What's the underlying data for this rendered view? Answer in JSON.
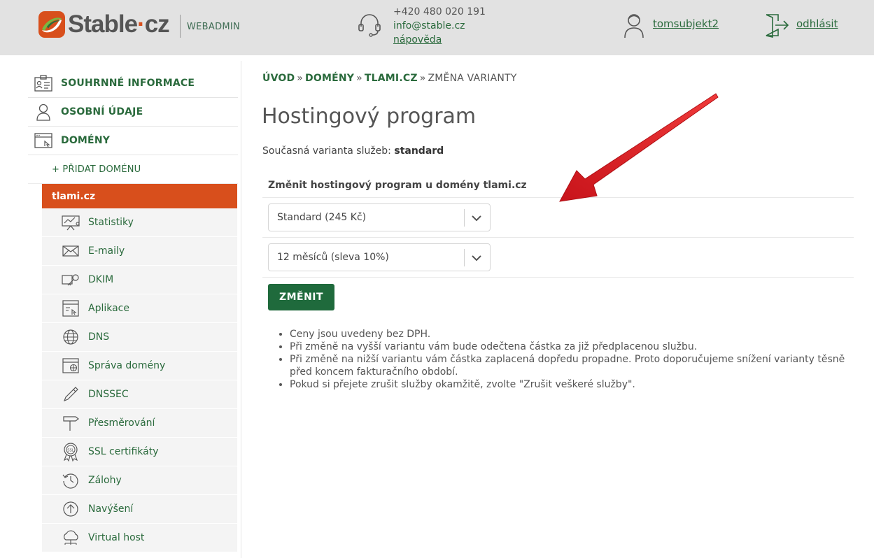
{
  "header": {
    "logo_text": "Stable",
    "logo_dot": "·",
    "logo_tld": "cz",
    "webadmin": "WEBADMIN",
    "phone": "+420 480 020 191",
    "email": "info@stable.cz",
    "help": "nápověda",
    "username": "tomsubjekt2",
    "logout": "odhlásit",
    "icons": [
      "support-icon",
      "user-icon",
      "logout-icon"
    ]
  },
  "colors": {
    "brand_orange": "#d84f1c",
    "brand_green": "#2a6a3c",
    "button_green": "#1f6a3c",
    "header_bg": "#e2e2e2"
  },
  "sidebar": {
    "top_items": [
      {
        "label": "SOUHRNNÉ INFORMACE",
        "icon": "summary-card-icon"
      },
      {
        "label": "OSOBNÍ ÚDAJE",
        "icon": "person-icon"
      },
      {
        "label": "DOMÉNY",
        "icon": "browser-window-icon"
      }
    ],
    "add_domain": "+ PŘIDAT DOMÉNU",
    "active_domain": "tlami.cz",
    "sub_items": [
      {
        "label": "Statistiky",
        "icon": "presentation-chart-icon"
      },
      {
        "label": "E-maily",
        "icon": "envelope-icon"
      },
      {
        "label": "DKIM",
        "icon": "key-icon"
      },
      {
        "label": "Aplikace",
        "icon": "app-window-icon"
      },
      {
        "label": "DNS",
        "icon": "globe-icon"
      },
      {
        "label": "Správa domény",
        "icon": "domain-window-icon"
      },
      {
        "label": "DNSSEC",
        "icon": "pen-icon"
      },
      {
        "label": "Přesměrování",
        "icon": "signpost-icon"
      },
      {
        "label": "SSL certifikáty",
        "icon": "ssl-badge-icon"
      },
      {
        "label": "Zálohy",
        "icon": "backup-clock-icon"
      },
      {
        "label": "Navýšení",
        "icon": "upgrade-arrow-icon"
      },
      {
        "label": "Virtual host",
        "icon": "cloud-host-icon"
      }
    ]
  },
  "main": {
    "breadcrumb": {
      "items": [
        "ÚVOD",
        "DOMÉNY",
        "TLAMI.CZ"
      ],
      "separator": "»",
      "current": "ZMĚNA VARIANTY"
    },
    "title": "Hostingový program",
    "current_variant_label": "Současná varianta služeb:",
    "current_variant_value": "standard",
    "form": {
      "title": "Změnit hostingový program u domény tlami.cz",
      "program_select": "Standard (245 Kč)",
      "period_select": "12 měsíců (sleva 10%)",
      "submit": "ZMĚNIT"
    },
    "notes": [
      "Ceny jsou uvedeny bez DPH.",
      "Při změně na vyšší variantu vám bude odečtena částka za již předplacenou službu.",
      "Při změně na nižší variantu vám částka zaplacená dopředu propadne. Proto doporučujeme snížení varianty těsně před koncem fakturačního období.",
      "Pokud si přejete zrušit služby okamžitě, zvolte \"Zrušit veškeré služby\"."
    ]
  }
}
